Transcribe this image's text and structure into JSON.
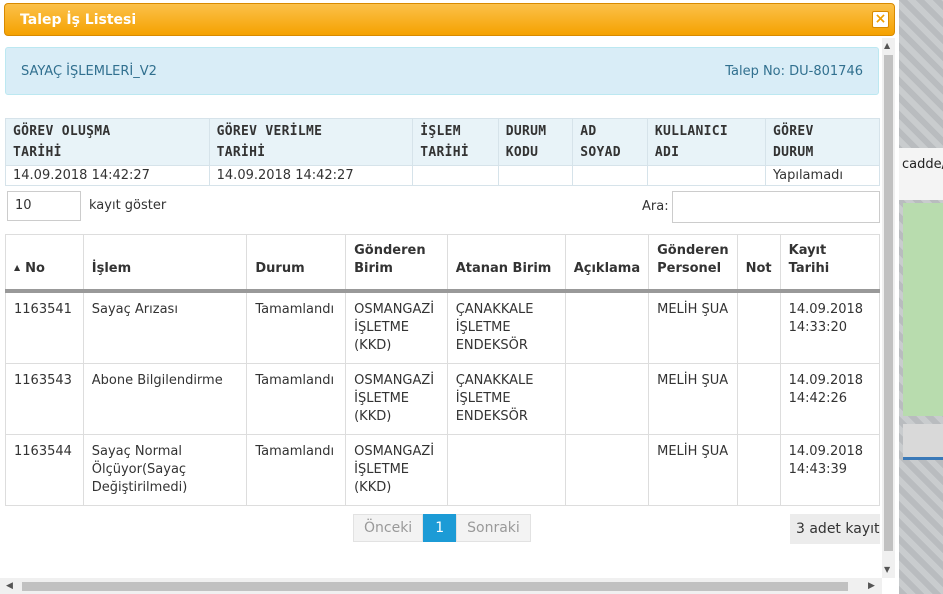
{
  "window": {
    "title": "Talep İş Listesi",
    "close_label": "×"
  },
  "background": {
    "partial_text": "cadde/"
  },
  "info": {
    "left": "SAYAÇ İŞLEMLERİ_V2",
    "right": "Talep No: DU-801746"
  },
  "summary": {
    "headers": [
      [
        "GÖREV OLUŞMA",
        "TARİHİ"
      ],
      [
        "GÖREV VERİLME",
        "TARİHİ"
      ],
      [
        "İŞLEM",
        "TARİHİ"
      ],
      [
        "DURUM",
        "KODU"
      ],
      [
        "AD",
        "SOYAD"
      ],
      [
        "KULLANICI",
        "ADI"
      ],
      [
        "GÖREV",
        "DURUM"
      ]
    ],
    "row": [
      "14.09.2018 14:42:27",
      "14.09.2018 14:42:27",
      "",
      "",
      "",
      "",
      "Yapılamadı"
    ]
  },
  "controls": {
    "page_length": "10",
    "length_label": "kayıt göster",
    "search_label": "Ara:",
    "search_value": ""
  },
  "grid": {
    "headers": [
      [
        "No"
      ],
      [
        "İşlem"
      ],
      [
        "Durum"
      ],
      [
        "Gönderen",
        "Birim"
      ],
      [
        "Atanan Birim"
      ],
      [
        "Açıklama"
      ],
      [
        "Gönderen",
        "Personel"
      ],
      [
        "Not"
      ],
      [
        "Kayıt Tarihi"
      ]
    ],
    "rows": [
      {
        "no": "1163541",
        "islem": [
          "Sayaç Arızası"
        ],
        "durum": "Tamamlandı",
        "gonderen_birim": [
          "OSMANGAZİ",
          "İŞLETME",
          "(KKD)"
        ],
        "atanan_birim": [
          "ÇANAKKALE",
          "İŞLETME",
          "ENDEKSÖR"
        ],
        "aciklama": "",
        "personel": "MELİH ŞUA",
        "not": "",
        "tarih": [
          "14.09.2018",
          "14:33:20"
        ]
      },
      {
        "no": "1163543",
        "islem": [
          "Abone Bilgilendirme"
        ],
        "durum": "Tamamlandı",
        "gonderen_birim": [
          "OSMANGAZİ",
          "İŞLETME",
          "(KKD)"
        ],
        "atanan_birim": [
          "ÇANAKKALE",
          "İŞLETME",
          "ENDEKSÖR"
        ],
        "aciklama": "",
        "personel": "MELİH ŞUA",
        "not": "",
        "tarih": [
          "14.09.2018",
          "14:42:26"
        ]
      },
      {
        "no": "1163544",
        "islem": [
          "Sayaç Normal",
          "Ölçüyor(Sayaç",
          "Değiştirilmedi)"
        ],
        "durum": "Tamamlandı",
        "gonderen_birim": [
          "OSMANGAZİ",
          "İŞLETME",
          "(KKD)"
        ],
        "atanan_birim": [],
        "aciklama": "",
        "personel": "MELİH ŞUA",
        "not": "",
        "tarih": [
          "14.09.2018",
          "14:43:39"
        ]
      }
    ]
  },
  "pagination": {
    "prev": "Önceki",
    "current": "1",
    "next": "Sonraki",
    "count": "3 adet kayıt"
  },
  "icons": {
    "sort": "sort-asc-icon",
    "scroll_up": "▲",
    "scroll_down": "▼",
    "scroll_left": "◀",
    "scroll_right": "▶"
  }
}
